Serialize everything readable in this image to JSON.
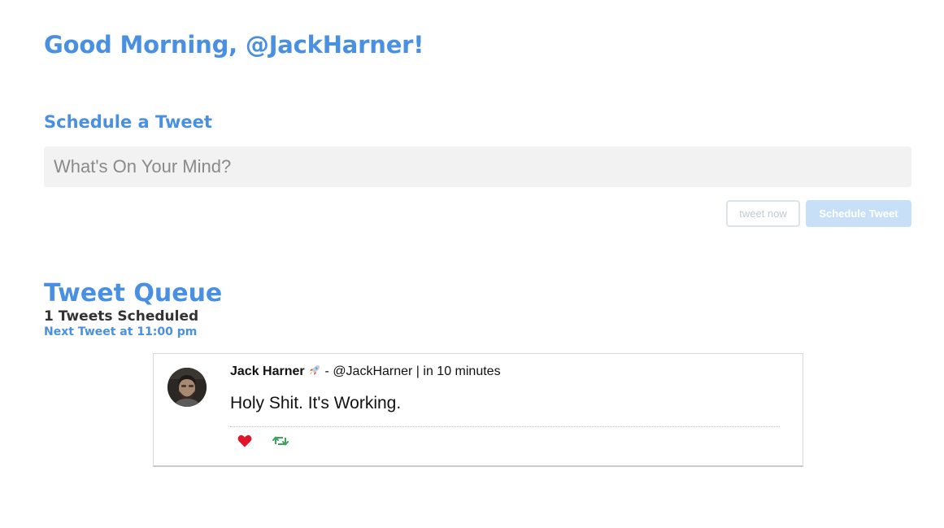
{
  "header": {
    "greeting": "Good Morning, @JackHarner!"
  },
  "composer": {
    "heading": "Schedule a Tweet",
    "input_value": "",
    "input_placeholder": "What's On Your Mind?",
    "tweet_now_label": "tweet now",
    "schedule_label": "Schedule Tweet"
  },
  "queue": {
    "title": "Tweet Queue",
    "count_text": "1 Tweets Scheduled",
    "next_text": "Next Tweet at 11:00 pm",
    "tweets": [
      {
        "author_name": "Jack Harner",
        "author_emoji": "🚀",
        "separator": " - ",
        "handle": "@JackHarner",
        "time_sep": " | ",
        "scheduled_time": "in 10 minutes",
        "text": "Holy Shit. It's Working.",
        "actions": {
          "like_icon": "heart-icon",
          "retweet_icon": "retweet-icon"
        }
      }
    ]
  },
  "colors": {
    "accent": "#4a90e2",
    "like": "#e0142b",
    "retweet": "#3aa55a",
    "schedule_button": "#c7e0f8",
    "input_background": "#f2f2f2"
  }
}
